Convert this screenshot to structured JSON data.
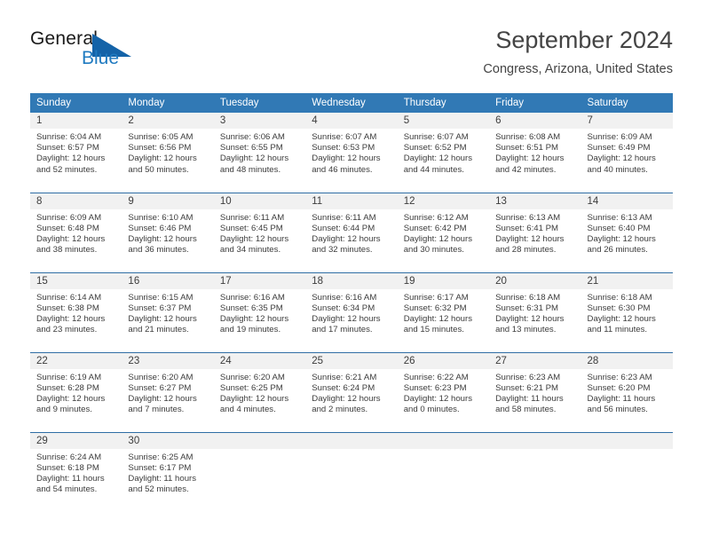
{
  "brand": {
    "name_part1": "General",
    "name_part2": "Blue",
    "triangle_icon": "triangle-logo-icon",
    "accent_color": "#1f7ac0"
  },
  "header": {
    "title": "September 2024",
    "subtitle": "Congress, Arizona, United States"
  },
  "calendar": {
    "header_bg": "#3179b5",
    "daynum_bg": "#f1f1f1",
    "weekday_labels": [
      "Sunday",
      "Monday",
      "Tuesday",
      "Wednesday",
      "Thursday",
      "Friday",
      "Saturday"
    ],
    "weeks": [
      [
        {
          "day": "1",
          "sunrise": "Sunrise: 6:04 AM",
          "sunset": "Sunset: 6:57 PM",
          "daylight_line1": "Daylight: 12 hours",
          "daylight_line2": "and 52 minutes."
        },
        {
          "day": "2",
          "sunrise": "Sunrise: 6:05 AM",
          "sunset": "Sunset: 6:56 PM",
          "daylight_line1": "Daylight: 12 hours",
          "daylight_line2": "and 50 minutes."
        },
        {
          "day": "3",
          "sunrise": "Sunrise: 6:06 AM",
          "sunset": "Sunset: 6:55 PM",
          "daylight_line1": "Daylight: 12 hours",
          "daylight_line2": "and 48 minutes."
        },
        {
          "day": "4",
          "sunrise": "Sunrise: 6:07 AM",
          "sunset": "Sunset: 6:53 PM",
          "daylight_line1": "Daylight: 12 hours",
          "daylight_line2": "and 46 minutes."
        },
        {
          "day": "5",
          "sunrise": "Sunrise: 6:07 AM",
          "sunset": "Sunset: 6:52 PM",
          "daylight_line1": "Daylight: 12 hours",
          "daylight_line2": "and 44 minutes."
        },
        {
          "day": "6",
          "sunrise": "Sunrise: 6:08 AM",
          "sunset": "Sunset: 6:51 PM",
          "daylight_line1": "Daylight: 12 hours",
          "daylight_line2": "and 42 minutes."
        },
        {
          "day": "7",
          "sunrise": "Sunrise: 6:09 AM",
          "sunset": "Sunset: 6:49 PM",
          "daylight_line1": "Daylight: 12 hours",
          "daylight_line2": "and 40 minutes."
        }
      ],
      [
        {
          "day": "8",
          "sunrise": "Sunrise: 6:09 AM",
          "sunset": "Sunset: 6:48 PM",
          "daylight_line1": "Daylight: 12 hours",
          "daylight_line2": "and 38 minutes."
        },
        {
          "day": "9",
          "sunrise": "Sunrise: 6:10 AM",
          "sunset": "Sunset: 6:46 PM",
          "daylight_line1": "Daylight: 12 hours",
          "daylight_line2": "and 36 minutes."
        },
        {
          "day": "10",
          "sunrise": "Sunrise: 6:11 AM",
          "sunset": "Sunset: 6:45 PM",
          "daylight_line1": "Daylight: 12 hours",
          "daylight_line2": "and 34 minutes."
        },
        {
          "day": "11",
          "sunrise": "Sunrise: 6:11 AM",
          "sunset": "Sunset: 6:44 PM",
          "daylight_line1": "Daylight: 12 hours",
          "daylight_line2": "and 32 minutes."
        },
        {
          "day": "12",
          "sunrise": "Sunrise: 6:12 AM",
          "sunset": "Sunset: 6:42 PM",
          "daylight_line1": "Daylight: 12 hours",
          "daylight_line2": "and 30 minutes."
        },
        {
          "day": "13",
          "sunrise": "Sunrise: 6:13 AM",
          "sunset": "Sunset: 6:41 PM",
          "daylight_line1": "Daylight: 12 hours",
          "daylight_line2": "and 28 minutes."
        },
        {
          "day": "14",
          "sunrise": "Sunrise: 6:13 AM",
          "sunset": "Sunset: 6:40 PM",
          "daylight_line1": "Daylight: 12 hours",
          "daylight_line2": "and 26 minutes."
        }
      ],
      [
        {
          "day": "15",
          "sunrise": "Sunrise: 6:14 AM",
          "sunset": "Sunset: 6:38 PM",
          "daylight_line1": "Daylight: 12 hours",
          "daylight_line2": "and 23 minutes."
        },
        {
          "day": "16",
          "sunrise": "Sunrise: 6:15 AM",
          "sunset": "Sunset: 6:37 PM",
          "daylight_line1": "Daylight: 12 hours",
          "daylight_line2": "and 21 minutes."
        },
        {
          "day": "17",
          "sunrise": "Sunrise: 6:16 AM",
          "sunset": "Sunset: 6:35 PM",
          "daylight_line1": "Daylight: 12 hours",
          "daylight_line2": "and 19 minutes."
        },
        {
          "day": "18",
          "sunrise": "Sunrise: 6:16 AM",
          "sunset": "Sunset: 6:34 PM",
          "daylight_line1": "Daylight: 12 hours",
          "daylight_line2": "and 17 minutes."
        },
        {
          "day": "19",
          "sunrise": "Sunrise: 6:17 AM",
          "sunset": "Sunset: 6:32 PM",
          "daylight_line1": "Daylight: 12 hours",
          "daylight_line2": "and 15 minutes."
        },
        {
          "day": "20",
          "sunrise": "Sunrise: 6:18 AM",
          "sunset": "Sunset: 6:31 PM",
          "daylight_line1": "Daylight: 12 hours",
          "daylight_line2": "and 13 minutes."
        },
        {
          "day": "21",
          "sunrise": "Sunrise: 6:18 AM",
          "sunset": "Sunset: 6:30 PM",
          "daylight_line1": "Daylight: 12 hours",
          "daylight_line2": "and 11 minutes."
        }
      ],
      [
        {
          "day": "22",
          "sunrise": "Sunrise: 6:19 AM",
          "sunset": "Sunset: 6:28 PM",
          "daylight_line1": "Daylight: 12 hours",
          "daylight_line2": "and 9 minutes."
        },
        {
          "day": "23",
          "sunrise": "Sunrise: 6:20 AM",
          "sunset": "Sunset: 6:27 PM",
          "daylight_line1": "Daylight: 12 hours",
          "daylight_line2": "and 7 minutes."
        },
        {
          "day": "24",
          "sunrise": "Sunrise: 6:20 AM",
          "sunset": "Sunset: 6:25 PM",
          "daylight_line1": "Daylight: 12 hours",
          "daylight_line2": "and 4 minutes."
        },
        {
          "day": "25",
          "sunrise": "Sunrise: 6:21 AM",
          "sunset": "Sunset: 6:24 PM",
          "daylight_line1": "Daylight: 12 hours",
          "daylight_line2": "and 2 minutes."
        },
        {
          "day": "26",
          "sunrise": "Sunrise: 6:22 AM",
          "sunset": "Sunset: 6:23 PM",
          "daylight_line1": "Daylight: 12 hours",
          "daylight_line2": "and 0 minutes."
        },
        {
          "day": "27",
          "sunrise": "Sunrise: 6:23 AM",
          "sunset": "Sunset: 6:21 PM",
          "daylight_line1": "Daylight: 11 hours",
          "daylight_line2": "and 58 minutes."
        },
        {
          "day": "28",
          "sunrise": "Sunrise: 6:23 AM",
          "sunset": "Sunset: 6:20 PM",
          "daylight_line1": "Daylight: 11 hours",
          "daylight_line2": "and 56 minutes."
        }
      ],
      [
        {
          "day": "29",
          "sunrise": "Sunrise: 6:24 AM",
          "sunset": "Sunset: 6:18 PM",
          "daylight_line1": "Daylight: 11 hours",
          "daylight_line2": "and 54 minutes."
        },
        {
          "day": "30",
          "sunrise": "Sunrise: 6:25 AM",
          "sunset": "Sunset: 6:17 PM",
          "daylight_line1": "Daylight: 11 hours",
          "daylight_line2": "and 52 minutes."
        },
        {
          "day": "",
          "sunrise": "",
          "sunset": "",
          "daylight_line1": "",
          "daylight_line2": ""
        },
        {
          "day": "",
          "sunrise": "",
          "sunset": "",
          "daylight_line1": "",
          "daylight_line2": ""
        },
        {
          "day": "",
          "sunrise": "",
          "sunset": "",
          "daylight_line1": "",
          "daylight_line2": ""
        },
        {
          "day": "",
          "sunrise": "",
          "sunset": "",
          "daylight_line1": "",
          "daylight_line2": ""
        },
        {
          "day": "",
          "sunrise": "",
          "sunset": "",
          "daylight_line1": "",
          "daylight_line2": ""
        }
      ]
    ]
  }
}
